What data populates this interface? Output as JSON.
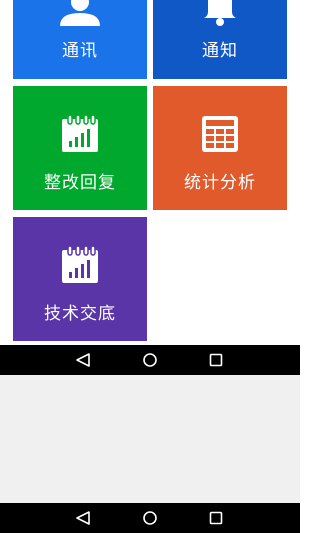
{
  "tiles": [
    {
      "label": "通讯",
      "icon": "contacts-icon",
      "color": "#1a73e8"
    },
    {
      "label": "通知",
      "icon": "bell-icon",
      "color": "#1158c7"
    },
    {
      "label": "整改回复",
      "icon": "calendar-chart-icon",
      "color": "#00a82d"
    },
    {
      "label": "统计分析",
      "icon": "table-icon",
      "color": "#e05a2b"
    },
    {
      "label": "技术交底",
      "icon": "calendar-chart-icon",
      "color": "#5a35a8"
    }
  ],
  "navbar": {
    "buttons": [
      "back-icon",
      "home-icon",
      "recents-icon"
    ]
  }
}
